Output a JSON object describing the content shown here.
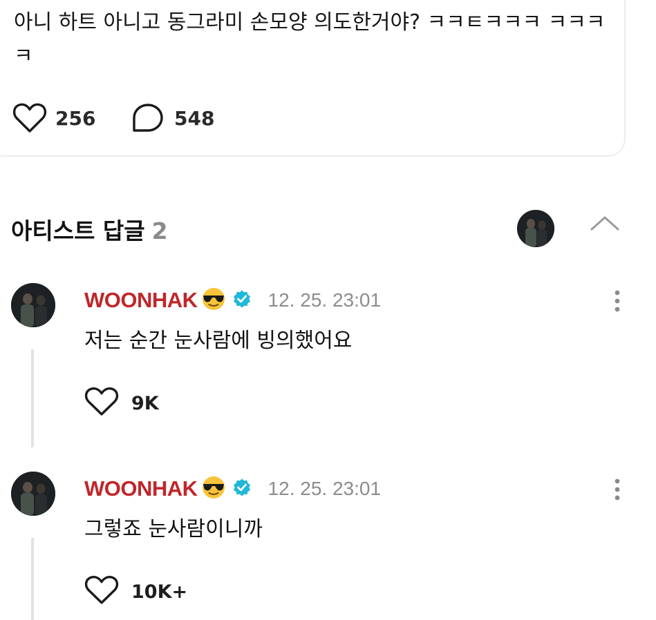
{
  "post": {
    "text": "아니 하트 아니고 동그라미 손모양 의도한거야? ㅋㅋㅌㅋㅋㅋ ㅋㅋㅋㅋ",
    "like_count": "256",
    "comment_count": "548"
  },
  "artist_replies": {
    "title": "아티스트 답글",
    "count": "2",
    "replies": [
      {
        "author": "WOONHAK",
        "emoji": "sunglasses-emoji",
        "verified": true,
        "time": "12. 25. 23:01",
        "text": "저는 순간 눈사람에 빙의했어요",
        "like_count": "9K"
      },
      {
        "author": "WOONHAK",
        "emoji": "sunglasses-emoji",
        "verified": true,
        "time": "12. 25. 23:01",
        "text": "그렇죠 눈사람이니까",
        "like_count": "10K+"
      }
    ]
  },
  "colors": {
    "author_name": "#c0262a",
    "verified_badge": "#20b8d8",
    "muted": "#8c8c8c"
  }
}
